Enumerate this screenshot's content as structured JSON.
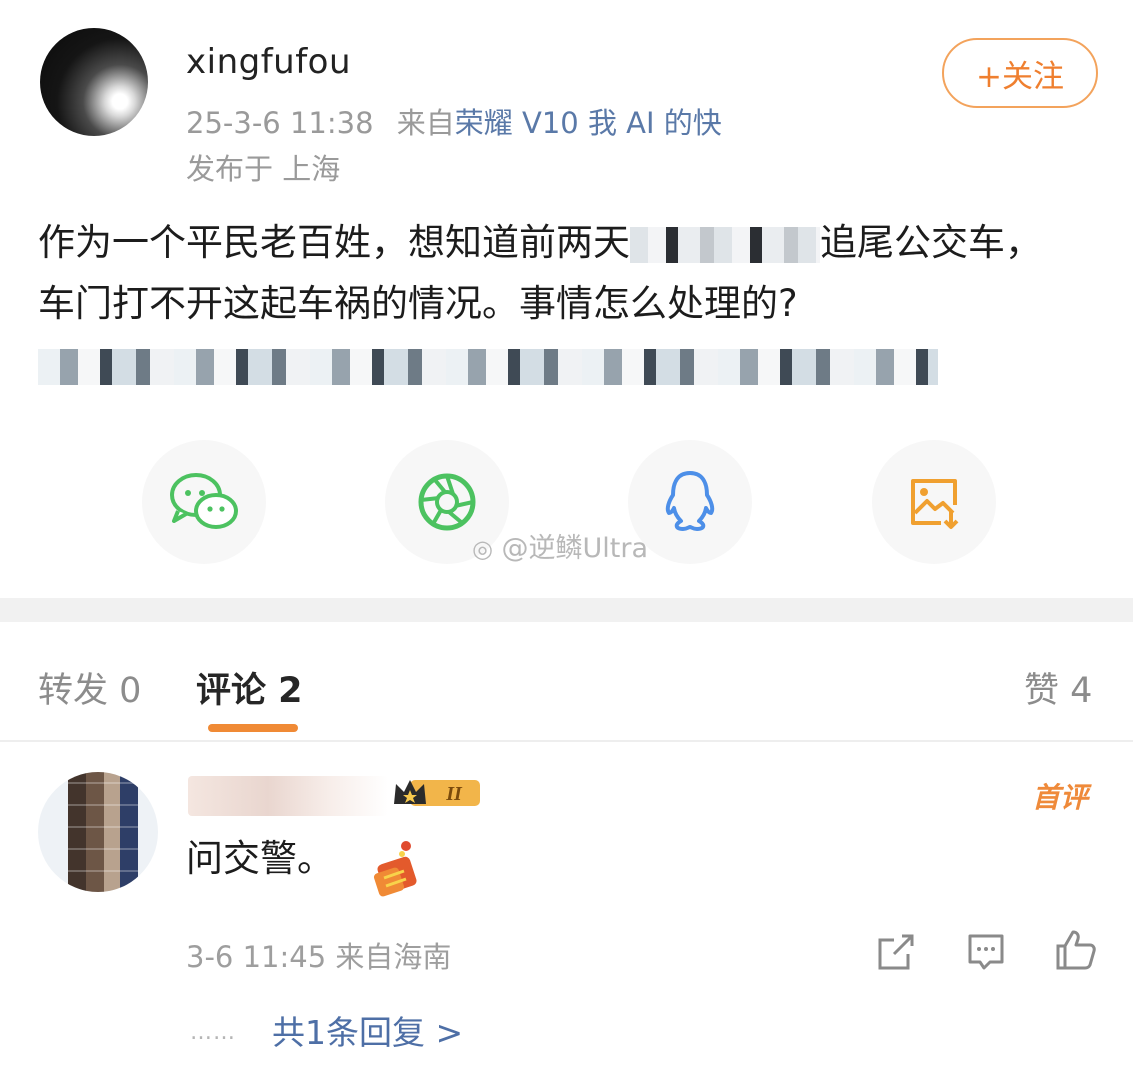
{
  "post": {
    "username": "xingfufou",
    "timestamp": "25-3-6 11:38",
    "source_prefix": "来自",
    "source_device": "荣耀 V10 我 AI 的快",
    "location": "发布于 上海",
    "follow_label": "+关注",
    "text_part1": "作为一个平民老百姓，想知道前两天",
    "text_part2": "追尾公交车，车门打不开这起车祸的情况。事情怎么处理的?"
  },
  "share": {
    "icons": [
      "wechat-icon",
      "moments-icon",
      "qq-icon",
      "save-image-icon"
    ],
    "watermark": "@逆鳞Ultra"
  },
  "tabs": {
    "repost": "转发 0",
    "comments": "评论 2",
    "likes": "赞 4"
  },
  "comment": {
    "text": "问交警。",
    "badge": "首评",
    "level": "II",
    "meta": "3-6 11:45 来自海南",
    "replies_dots": "……",
    "replies_link": "共1条回复 >"
  },
  "colors": {
    "accent_orange": "#f08a35",
    "link_blue": "#4e6fa6",
    "wechat_green": "#4cc260",
    "qq_blue": "#4d8fe8",
    "save_orange": "#f0a030"
  }
}
